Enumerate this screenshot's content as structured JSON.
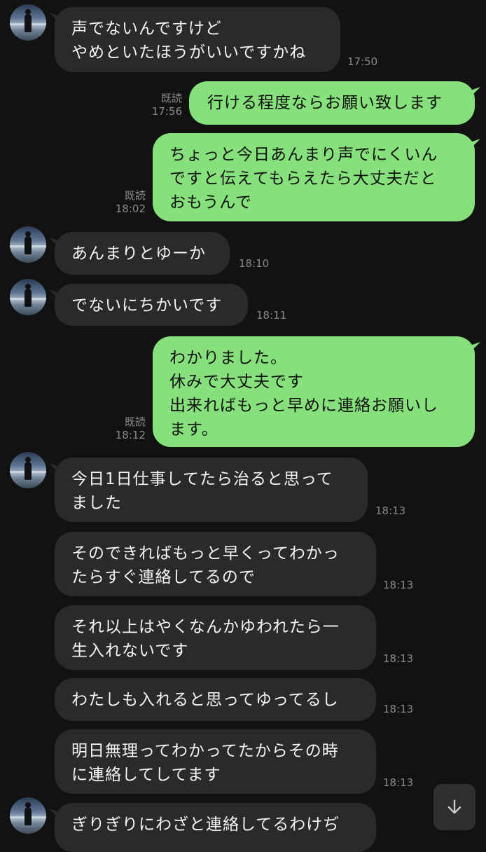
{
  "messages": [
    {
      "id": 1,
      "sender": "other",
      "text": "声でないんですけど\nやめといたほうがいいですかね",
      "time": "17:50"
    },
    {
      "id": 2,
      "sender": "me",
      "text": "行ける程度ならお願い致します",
      "read": "既読",
      "time": "17:56"
    },
    {
      "id": 3,
      "sender": "me",
      "text": "ちょっと今日あんまり声でにくいん\nですと伝えてもらえたら大丈夫だと\nおもうんで",
      "read": "既読",
      "time": "18:02"
    },
    {
      "id": 4,
      "sender": "other",
      "text": "あんまりとゆーか",
      "time": "18:10"
    },
    {
      "id": 5,
      "sender": "other",
      "text": "でないにちかいです",
      "time": "18:11"
    },
    {
      "id": 6,
      "sender": "me",
      "text": "わかりました。\n休みで大丈夫です\n出来ればもっと早めに連絡お願いし\nます。",
      "read": "既読",
      "time": "18:12"
    },
    {
      "id": 7,
      "sender": "other",
      "text": "今日1日仕事してたら治ると思って\nました",
      "time": "18:13"
    },
    {
      "id": 8,
      "sender": "other",
      "text": "そのできればもっと早くってわかっ\nたらすぐ連絡してるので",
      "time": "18:13"
    },
    {
      "id": 9,
      "sender": "other",
      "text": "それ以上はやくなんかゆわれたら一\n生入れないです",
      "time": "18:13"
    },
    {
      "id": 10,
      "sender": "other",
      "text": "わたしも入れると思ってゆってるし",
      "time": "18:13"
    },
    {
      "id": 11,
      "sender": "other",
      "text": "明日無理ってわかってたからその時\nに連絡してしてます",
      "time": "18:13"
    },
    {
      "id": 12,
      "sender": "other",
      "text": "ぎりぎりにわざと連絡してるわけぢ",
      "time": ""
    }
  ],
  "icons": {
    "avatar": "avatar-icon",
    "scroll_down": "arrow-down-icon"
  },
  "colors": {
    "background": "#121212",
    "incoming_bubble": "#2a2a2a",
    "outgoing_bubble": "#86e07b",
    "meta_text": "#8a8a8a"
  }
}
